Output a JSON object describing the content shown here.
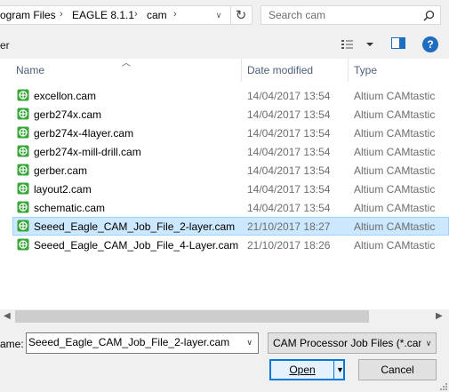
{
  "address_bar": {
    "segments": [
      "ogram Files",
      "EAGLE 8.1.1",
      "cam"
    ]
  },
  "search": {
    "placeholder": "Search cam"
  },
  "toolbar": {
    "cutoff_label": "er"
  },
  "columns": {
    "name": "Name",
    "date": "Date modified",
    "type": "Type"
  },
  "files": [
    {
      "name": "excellon.cam",
      "date": "14/04/2017 13:54",
      "type": "Altium CAMtastic"
    },
    {
      "name": "gerb274x.cam",
      "date": "14/04/2017 13:54",
      "type": "Altium CAMtastic"
    },
    {
      "name": "gerb274x-4layer.cam",
      "date": "14/04/2017 13:54",
      "type": "Altium CAMtastic"
    },
    {
      "name": "gerb274x-mill-drill.cam",
      "date": "14/04/2017 13:54",
      "type": "Altium CAMtastic"
    },
    {
      "name": "gerber.cam",
      "date": "14/04/2017 13:54",
      "type": "Altium CAMtastic"
    },
    {
      "name": "layout2.cam",
      "date": "14/04/2017 13:54",
      "type": "Altium CAMtastic"
    },
    {
      "name": "schematic.cam",
      "date": "14/04/2017 13:54",
      "type": "Altium CAMtastic"
    },
    {
      "name": "Seeed_Eagle_CAM_Job_File_2-layer.cam",
      "date": "21/10/2017 18:27",
      "type": "Altium CAMtastic"
    },
    {
      "name": "Seeed_Eagle_CAM_Job_File_4-Layer.cam",
      "date": "21/10/2017 18:26",
      "type": "Altium CAMtastic"
    }
  ],
  "selected_index": 7,
  "filename": {
    "label": "ame:",
    "value": "Seeed_Eagle_CAM_Job_File_2-layer.cam"
  },
  "file_type_filter": {
    "selected": "CAM Processor Job Files (*.cam"
  },
  "buttons": {
    "open": "Open",
    "cancel": "Cancel"
  },
  "colors": {
    "selection_bg": "#cce8ff",
    "selection_border": "#99d1ff",
    "accent": "#0078d7",
    "file_icon": "#3aa53a"
  }
}
